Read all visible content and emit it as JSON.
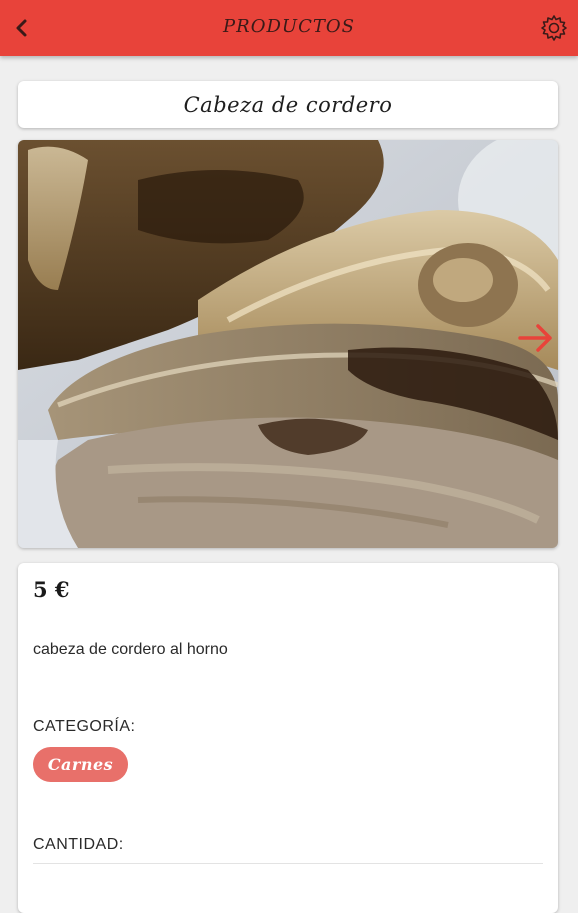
{
  "header": {
    "title": "PRODUCTOS",
    "back_icon": "chevron-left-icon",
    "settings_icon": "gear-icon",
    "background_color": "#e8433a"
  },
  "product": {
    "name": "Cabeza de cordero",
    "image": "roasted-lamb-head-photo",
    "next_icon": "arrow-right-icon",
    "price": "5 €",
    "description": "cabeza de cordero al horno",
    "category_label": "CATEGORÍA:",
    "category": "Carnes",
    "category_color": "#e8706a",
    "quantity_label": "CANTIDAD:"
  }
}
